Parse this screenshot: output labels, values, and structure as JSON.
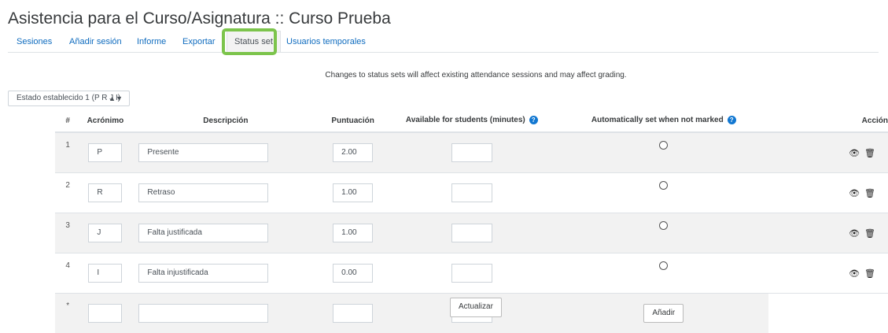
{
  "page": {
    "title": "Asistencia para el Curso/Asignatura :: Curso Prueba",
    "notice": "Changes to status sets will affect existing attendance sessions and may affect grading."
  },
  "tabs": [
    {
      "label": "Sesiones"
    },
    {
      "label": "Añadir sesión"
    },
    {
      "label": "Informe"
    },
    {
      "label": "Exportar"
    },
    {
      "label": "Status set",
      "active": true
    },
    {
      "label": "Usuarios temporales"
    }
  ],
  "status_set_select": {
    "value": "Estado establecido 1 (P R J I)"
  },
  "table": {
    "headers": [
      "#",
      "Acrónimo",
      "Descripción",
      "Puntuación",
      "Available for students (minutes)",
      "Automatically set when not marked",
      "Acción"
    ],
    "rows": [
      {
        "num": "1",
        "acronym": "P",
        "description": "Presente",
        "points": "2.00",
        "available": "",
        "auto_selected": false
      },
      {
        "num": "2",
        "acronym": "R",
        "description": "Retraso",
        "points": "1.00",
        "available": "",
        "auto_selected": false
      },
      {
        "num": "3",
        "acronym": "J",
        "description": "Falta justificada",
        "points": "1.00",
        "available": "",
        "auto_selected": false
      },
      {
        "num": "4",
        "acronym": "I",
        "description": "Falta injustificada",
        "points": "0.00",
        "available": "",
        "auto_selected": false
      }
    ],
    "new_row": {
      "num": "*",
      "acronym": "",
      "description": "",
      "points": "",
      "available": "",
      "add_label": "Añadir"
    }
  },
  "buttons": {
    "update_label": "Actualizar"
  },
  "icons": {
    "help": "help-icon",
    "hide": "eye-icon",
    "delete": "trash-icon"
  },
  "colors": {
    "accent": "#0f6cbf",
    "highlight": "#7cc44c",
    "help": "#1177d1"
  }
}
